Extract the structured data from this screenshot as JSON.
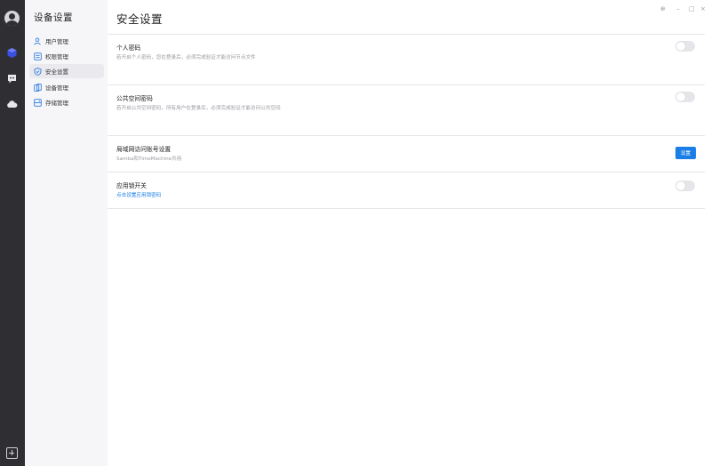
{
  "sidebar": {
    "title": "设备设置",
    "items": [
      {
        "label": "用户管理",
        "icon": "user-icon"
      },
      {
        "label": "权限管理",
        "icon": "permission-icon"
      },
      {
        "label": "安全设置",
        "icon": "shield-icon",
        "active": true
      },
      {
        "label": "设备管理",
        "icon": "device-icon"
      },
      {
        "label": "存储管理",
        "icon": "storage-icon"
      }
    ]
  },
  "page": {
    "title": "安全设置"
  },
  "settings": [
    {
      "label": "个人密码",
      "desc": "若开启个人密码，您在登录后，必须完成验证才能访问节点文件",
      "control": "toggle",
      "on": false
    },
    {
      "label": "公共空间密码",
      "desc": "若开启公共空间密码，所有用户在登录后，必须完成验证才能访问公共空间",
      "control": "toggle",
      "on": false
    },
    {
      "label": "局域网访问账号设置",
      "desc": "Samba和TimeMachine共用",
      "control": "button",
      "button_label": "设置"
    },
    {
      "label": "应用锁开关",
      "desc": "点击设置应用锁密码",
      "control": "toggle",
      "on": false
    }
  ],
  "window": {
    "pin": "⊕",
    "minimize": "–",
    "maximize": "□",
    "close": "×"
  },
  "colors": {
    "rail_bg": "#2f2f33",
    "sidebar_bg": "#f6f6f8",
    "accent": "#1a7ee6",
    "toggle_off": "#e6e6ea"
  }
}
